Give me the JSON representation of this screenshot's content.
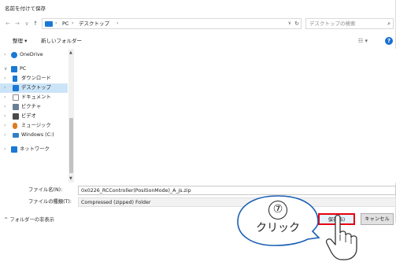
{
  "window": {
    "title": "名前を付けて保存"
  },
  "address_bar": {
    "back_icon": "←",
    "forward_icon": "→",
    "recent_icon": "∨",
    "up_icon": "↑",
    "path": [
      "PC",
      "デスクトップ"
    ],
    "separator": "›",
    "dropdown_icon": "∨",
    "refresh_icon": "↻"
  },
  "search": {
    "placeholder": "デスクトップの検索",
    "icon": "⌕"
  },
  "toolbar": {
    "organize_label": "整理 ▾",
    "new_folder_label": "新しいフォルダー",
    "view_icon": "☷ ▾",
    "help_icon": "?"
  },
  "nav_pane": {
    "items": [
      {
        "label": "OneDrive",
        "icon": "cloud-icon",
        "color": "#1a78d6",
        "chevron": "›",
        "level": 0
      },
      {
        "label": "PC",
        "icon": "pc-icon",
        "color": "#1a78d6",
        "chevron": "∨",
        "level": 0
      },
      {
        "label": "ダウンロード",
        "icon": "download-icon",
        "color": "#1a78d6",
        "chevron": "›",
        "level": 1
      },
      {
        "label": "デスクトップ",
        "icon": "desktop-icon",
        "color": "#1a78d6",
        "chevron": "›",
        "level": 1,
        "selected": true
      },
      {
        "label": "ドキュメント",
        "icon": "documents-icon",
        "color": "#8a8a8a",
        "chevron": "›",
        "level": 1
      },
      {
        "label": "ピクチャ",
        "icon": "pictures-icon",
        "color": "#6a7f96",
        "chevron": "›",
        "level": 1
      },
      {
        "label": "ビデオ",
        "icon": "videos-icon",
        "color": "#4a4a4a",
        "chevron": "›",
        "level": 1
      },
      {
        "label": "ミュージック",
        "icon": "music-icon",
        "color": "#e07a1f",
        "chevron": "›",
        "level": 1
      },
      {
        "label": "Windows (C:)",
        "icon": "drive-icon",
        "color": "#2f7fc8",
        "chevron": "›",
        "level": 1
      },
      {
        "label": "ネットワーク",
        "icon": "network-icon",
        "color": "#1a78d6",
        "chevron": "›",
        "level": 0
      }
    ]
  },
  "fields": {
    "filename_label": "ファイル名(N):",
    "filename_value": "0x0226_RCController(PositionMode)_A_js.zip",
    "type_label": "ファイルの種類(T):",
    "type_value": "Compressed (zipped) Folder"
  },
  "footer": {
    "hide_folders_label": "^ フォルダーの非表示",
    "save_label": "保存(S)",
    "cancel_label": "キャンセル"
  },
  "callout": {
    "number": "⑦",
    "text": "クリック"
  },
  "colors": {
    "highlight": "#e60012",
    "selection": "#cce4f7",
    "accent": "#1a78d6"
  }
}
